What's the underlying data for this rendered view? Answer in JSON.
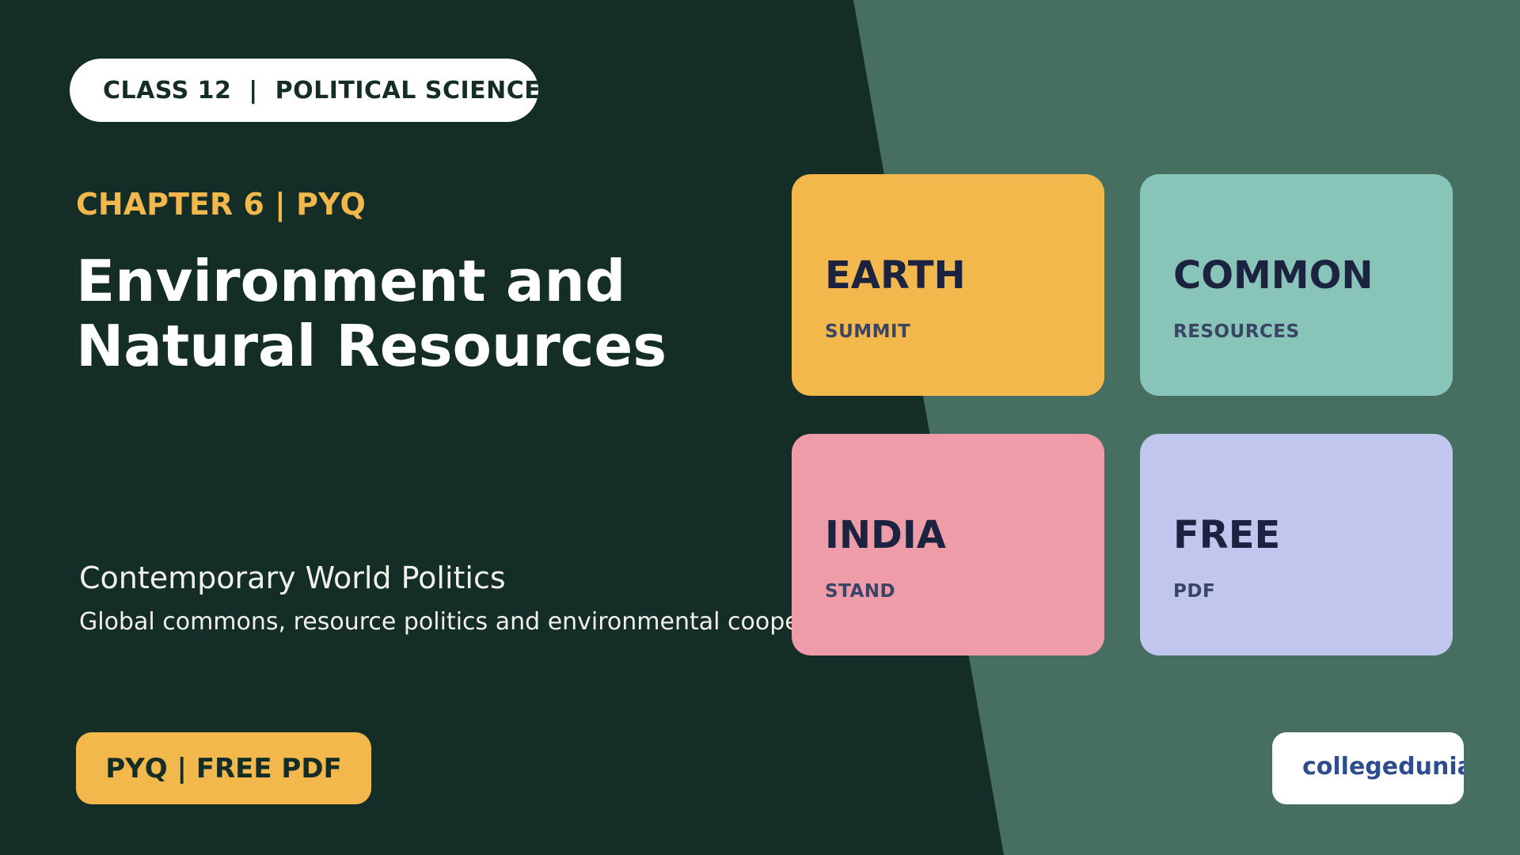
{
  "header": {
    "class_pill": "CLASS 12  |  POLITICAL SCIENCE"
  },
  "hero": {
    "chapter": "CHAPTER 6 | PYQ",
    "title_line1": "Environment and",
    "title_line2": "Natural Resources",
    "subtitle": "Contemporary World Politics",
    "tagline": "Global commons, resource politics and environmental cooperation"
  },
  "cards": [
    {
      "word": "EARTH",
      "sub": "SUMMIT"
    },
    {
      "word": "COMMON",
      "sub": "RESOURCES"
    },
    {
      "word": "INDIA",
      "sub": "STAND"
    },
    {
      "word": "FREE",
      "sub": "PDF"
    }
  ],
  "cta": {
    "label": "PYQ | FREE PDF"
  },
  "brand": {
    "logo_text": "collegedunia"
  },
  "colors": {
    "background": "#142d26",
    "panel": "#466f62",
    "accent": "#f2b84b",
    "card_earth": "#f2b84b",
    "card_common": "#88c5b8",
    "card_india": "#ef9ca9",
    "card_free": "#c1c6ee",
    "brand": "#2f4d8e"
  }
}
